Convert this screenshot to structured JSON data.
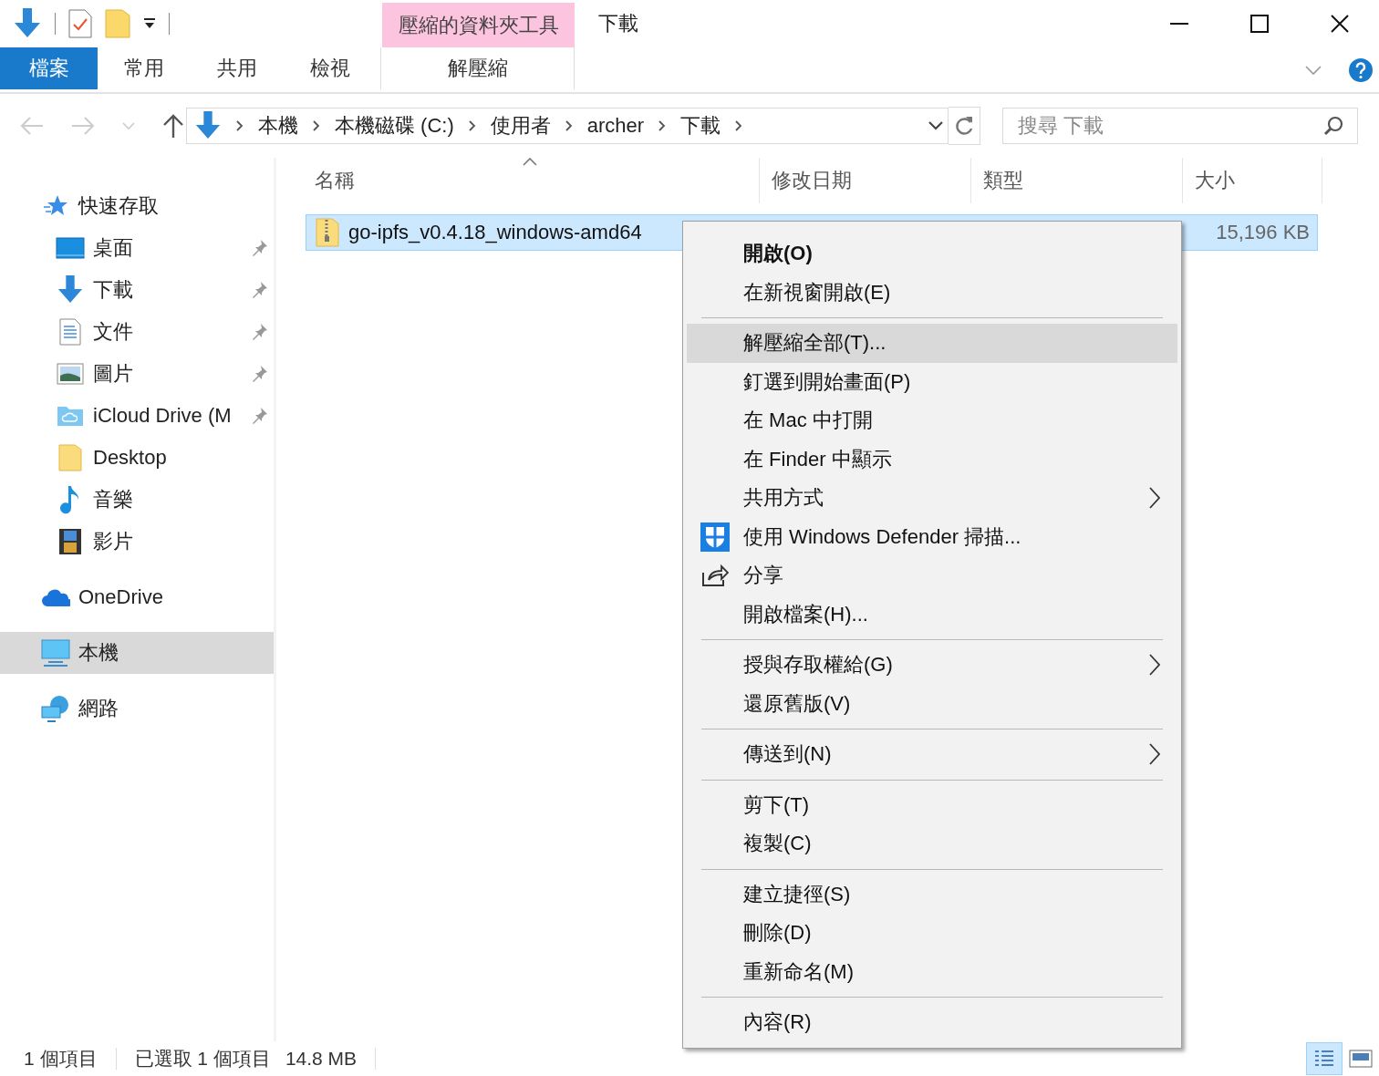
{
  "window": {
    "title": "下載",
    "contextual_group": "壓縮的資料夾工具"
  },
  "ribbon_tabs": [
    {
      "label": "檔案",
      "kind": "file",
      "selected": false
    },
    {
      "label": "常用",
      "kind": "normal",
      "selected": false
    },
    {
      "label": "共用",
      "kind": "normal",
      "selected": false
    },
    {
      "label": "檢視",
      "kind": "normal",
      "selected": false
    },
    {
      "label": "解壓縮",
      "kind": "contextual",
      "selected": false
    }
  ],
  "address_bar": {
    "breadcrumbs": [
      "本機",
      "本機磁碟 (C:)",
      "使用者",
      "archer",
      "下載"
    ]
  },
  "search": {
    "placeholder": "搜尋 下載"
  },
  "sidebar": [
    {
      "label": "快速存取",
      "kind": "star",
      "selected": false,
      "children": [
        {
          "label": "桌面",
          "kind": "desktop",
          "pinned": true,
          "selected": false
        },
        {
          "label": "下載",
          "kind": "download",
          "pinned": true,
          "selected": false
        },
        {
          "label": "文件",
          "kind": "document",
          "pinned": true,
          "selected": false
        },
        {
          "label": "圖片",
          "kind": "pictures",
          "pinned": true,
          "selected": false
        },
        {
          "label": "iCloud Drive (M",
          "kind": "cloudfolder",
          "pinned": true,
          "selected": false
        },
        {
          "label": "Desktop",
          "kind": "folder",
          "pinned": false,
          "selected": false
        },
        {
          "label": "音樂",
          "kind": "music",
          "pinned": false,
          "selected": false
        },
        {
          "label": "影片",
          "kind": "video",
          "pinned": false,
          "selected": false
        }
      ]
    },
    {
      "label": "OneDrive",
      "kind": "onedrive",
      "selected": false
    },
    {
      "label": "本機",
      "kind": "computer",
      "selected": true
    },
    {
      "label": "網路",
      "kind": "network",
      "selected": false
    }
  ],
  "table": {
    "columns": [
      {
        "label": "名稱",
        "sorted": true
      },
      {
        "label": "修改日期",
        "sorted": false
      },
      {
        "label": "類型",
        "sorted": false
      },
      {
        "label": "大小",
        "sorted": false
      }
    ],
    "rows": [
      {
        "name": "go-ipfs_v0.4.18_windows-amd64",
        "size": "15,196 KB",
        "selected": true
      }
    ]
  },
  "context_menu": [
    [
      {
        "label": "開啟(O)",
        "kind": "plain",
        "default": true,
        "selected": false,
        "submenu": false
      },
      {
        "label": "在新視窗開啟(E)",
        "kind": "plain",
        "default": false,
        "selected": false,
        "submenu": false
      }
    ],
    [
      {
        "label": "解壓縮全部(T)...",
        "kind": "plain",
        "default": false,
        "selected": true,
        "submenu": false
      },
      {
        "label": "釘選到開始畫面(P)",
        "kind": "plain",
        "default": false,
        "selected": false,
        "submenu": false
      },
      {
        "label": "在 Mac 中打開",
        "kind": "plain",
        "default": false,
        "selected": false,
        "submenu": false
      },
      {
        "label": "在 Finder 中顯示",
        "kind": "plain",
        "default": false,
        "selected": false,
        "submenu": false
      },
      {
        "label": "共用方式",
        "kind": "plain",
        "default": false,
        "selected": false,
        "submenu": true
      },
      {
        "label": "使用 Windows Defender 掃描...",
        "kind": "shield",
        "default": false,
        "selected": false,
        "submenu": false
      },
      {
        "label": "分享",
        "kind": "share",
        "default": false,
        "selected": false,
        "submenu": false
      },
      {
        "label": "開啟檔案(H)...",
        "kind": "plain",
        "default": false,
        "selected": false,
        "submenu": false
      }
    ],
    [
      {
        "label": "授與存取權給(G)",
        "kind": "plain",
        "default": false,
        "selected": false,
        "submenu": true
      },
      {
        "label": "還原舊版(V)",
        "kind": "plain",
        "default": false,
        "selected": false,
        "submenu": false
      }
    ],
    [
      {
        "label": "傳送到(N)",
        "kind": "plain",
        "default": false,
        "selected": false,
        "submenu": true
      }
    ],
    [
      {
        "label": "剪下(T)",
        "kind": "plain",
        "default": false,
        "selected": false,
        "submenu": false
      },
      {
        "label": "複製(C)",
        "kind": "plain",
        "default": false,
        "selected": false,
        "submenu": false
      }
    ],
    [
      {
        "label": "建立捷徑(S)",
        "kind": "plain",
        "default": false,
        "selected": false,
        "submenu": false
      },
      {
        "label": "刪除(D)",
        "kind": "plain",
        "default": false,
        "selected": false,
        "submenu": false
      },
      {
        "label": "重新命名(M)",
        "kind": "plain",
        "default": false,
        "selected": false,
        "submenu": false
      }
    ],
    [
      {
        "label": "內容(R)",
        "kind": "plain",
        "default": false,
        "selected": false,
        "submenu": false
      }
    ]
  ],
  "status_bar": {
    "item_count": "1 個項目",
    "selection": "已選取 1 個項目",
    "selection_size": "14.8 MB"
  },
  "view_buttons": [
    {
      "kind": "details",
      "selected": true
    },
    {
      "kind": "tiles",
      "selected": false
    }
  ]
}
